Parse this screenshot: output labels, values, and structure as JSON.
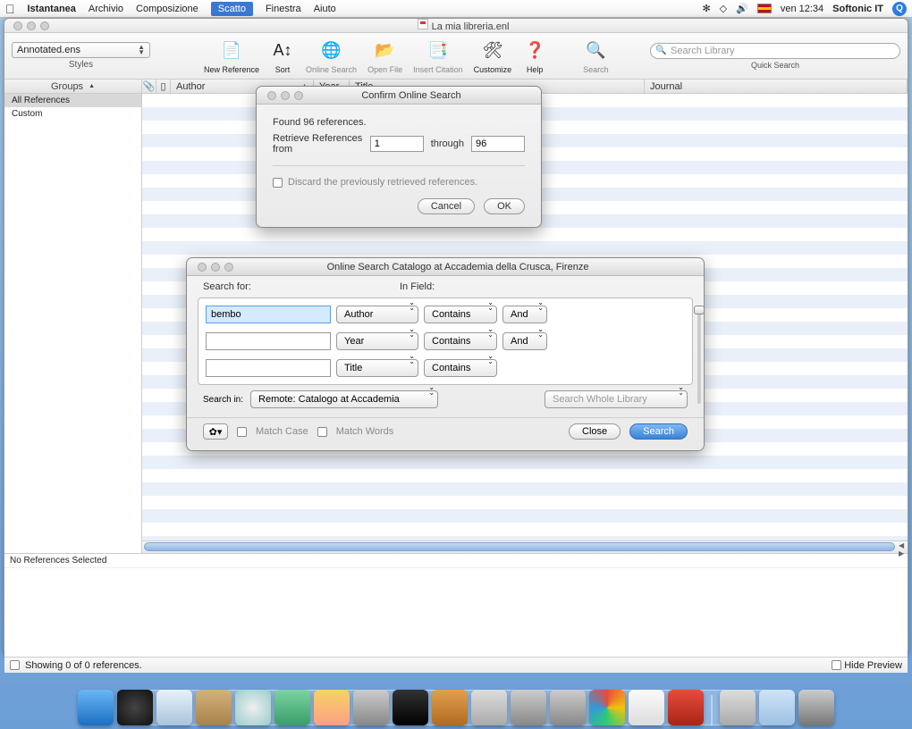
{
  "menubar": {
    "app": "Istantanea",
    "items": [
      "Archivio",
      "Composizione",
      "Scatto",
      "Finestra",
      "Aiuto"
    ],
    "selected_index": 2,
    "clock": "ven 12:34",
    "account": "Softonic IT"
  },
  "window": {
    "title": "La mia libreria.enl",
    "style_selected": "Annotated.ens",
    "styles_label": "Styles",
    "toolbar": [
      {
        "label": "New Reference",
        "active": true
      },
      {
        "label": "Sort",
        "active": true
      },
      {
        "label": "Online Search",
        "active": false
      },
      {
        "label": "Open File",
        "active": false
      },
      {
        "label": "Insert Citation",
        "active": false
      },
      {
        "label": "Customize",
        "active": true
      },
      {
        "label": "Help",
        "active": true
      }
    ],
    "search_tool_label": "Search",
    "quick_search_placeholder": "Search Library",
    "quick_search_label": "Quick Search",
    "sidebar_header": "Groups",
    "sidebar": [
      "All References",
      "Custom"
    ],
    "columns": {
      "author": "Author",
      "year": "Year",
      "title": "Title",
      "journal": "Journal"
    },
    "preview_label": "No References Selected",
    "status": "Showing 0 of 0 references.",
    "hide_preview": "Hide Preview"
  },
  "dlg_confirm": {
    "title": "Confirm Online Search",
    "found": "Found 96 references.",
    "retrieve_label": "Retrieve References from",
    "from": "1",
    "through_label": "through",
    "through": "96",
    "discard": "Discard the previously retrieved references.",
    "cancel": "Cancel",
    "ok": "OK"
  },
  "dlg_search": {
    "title": "Online Search Catalogo at Accademia della Crusca, Firenze",
    "search_for": "Search for:",
    "in_field": "In Field:",
    "rows": [
      {
        "term": "bembo",
        "field": "Author",
        "op": "Contains",
        "join": "And",
        "active": true
      },
      {
        "term": "",
        "field": "Year",
        "op": "Contains",
        "join": "And"
      },
      {
        "term": "",
        "field": "Title",
        "op": "Contains",
        "join": ""
      }
    ],
    "search_in_label": "Search in:",
    "search_in_value": "Remote: Catalogo at Accademia",
    "whole_library": "Search Whole Library",
    "match_case": "Match Case",
    "match_words": "Match Words",
    "close": "Close",
    "search": "Search"
  },
  "dock_icons": [
    {
      "name": "finder",
      "bg": "linear-gradient(#6ab7f5,#1b6fc4)"
    },
    {
      "name": "dashboard",
      "bg": "radial-gradient(#444,#111)"
    },
    {
      "name": "safari",
      "bg": "linear-gradient(#e8f2fa,#a8c4dc)"
    },
    {
      "name": "address-book",
      "bg": "linear-gradient(#d4b27c,#a7824b)"
    },
    {
      "name": "cd",
      "bg": "radial-gradient(#eee,#9cc)"
    },
    {
      "name": "itunes",
      "bg": "linear-gradient(#7bd3a0,#3a9e6a)"
    },
    {
      "name": "iphoto",
      "bg": "linear-gradient(#f6d365,#fda085)"
    },
    {
      "name": "image-capture",
      "bg": "linear-gradient(#ccc,#888)"
    },
    {
      "name": "imovie",
      "bg": "linear-gradient(#333,#000)"
    },
    {
      "name": "garageband",
      "bg": "linear-gradient(#e0a050,#b26a20)"
    },
    {
      "name": "tools",
      "bg": "linear-gradient(#ddd,#aaa)"
    },
    {
      "name": "utilities",
      "bg": "linear-gradient(#ccc,#888)"
    },
    {
      "name": "preferences",
      "bg": "linear-gradient(#ccc,#888)"
    },
    {
      "name": "swirl",
      "bg": "conic-gradient(#e74c3c,#f1c40f,#2ecc71,#3498db,#e74c3c)"
    },
    {
      "name": "textedit",
      "bg": "linear-gradient(#fafafa,#ddd)"
    },
    {
      "name": "endnote",
      "bg": "linear-gradient(#e74c3c,#a82516)"
    }
  ],
  "dock_right": [
    {
      "name": "mail",
      "bg": "linear-gradient(#ddd,#aaa)"
    },
    {
      "name": "documents",
      "bg": "linear-gradient(#cfe3f6,#9cc1e4)"
    },
    {
      "name": "trash",
      "bg": "linear-gradient(#ccc,#777)"
    }
  ]
}
